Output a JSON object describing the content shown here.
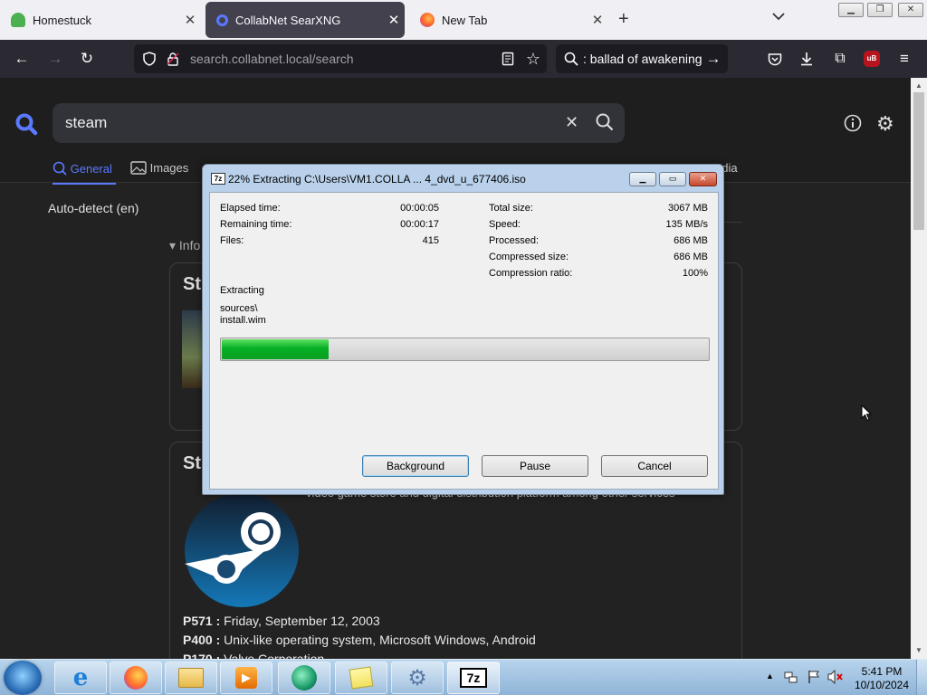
{
  "browser": {
    "tabs": [
      {
        "title": "Homestuck"
      },
      {
        "title": "CollabNet SearXNG"
      },
      {
        "title": "New Tab"
      }
    ],
    "url_domain": "search.collabnet.local",
    "url_path": "/search",
    "search_bar_text": ": ballad of awakening",
    "ublock_badge": "uB"
  },
  "searx": {
    "query": "steam",
    "tabs": {
      "general": "General",
      "images": "Images",
      "media": "edia"
    },
    "language": "Auto-detect (en)",
    "info_label": "▾ Info",
    "infobox_title": "St",
    "infobox2_title": "St",
    "description_fragment": "video game store and digital distribution platform among other services",
    "properties": [
      {
        "key": "P571 :",
        "value": " Friday, September 12, 2003"
      },
      {
        "key": "P400 :",
        "value": " Unix-like operating system, Microsoft Windows, Android"
      },
      {
        "key": "P170 :",
        "value": " Valve Corporation"
      }
    ]
  },
  "dialog": {
    "title": "22% Extracting C:\\Users\\VM1.COLLA ... 4_dvd_u_677406.iso",
    "icon_text": "7z",
    "progress_fraction": 0.22,
    "stats_left": [
      {
        "label": "Elapsed time:",
        "value": "00:00:05"
      },
      {
        "label": "Remaining time:",
        "value": "00:00:17"
      },
      {
        "label": "Files:",
        "value": "415"
      }
    ],
    "stats_right": [
      {
        "label": "Total size:",
        "value": "3067 MB"
      },
      {
        "label": "Speed:",
        "value": "135 MB/s"
      },
      {
        "label": "Processed:",
        "value": "686 MB"
      },
      {
        "label": "Compressed size:",
        "value": "686 MB"
      },
      {
        "label": "Compression ratio:",
        "value": "100%"
      }
    ],
    "operation": "Extracting",
    "path_line1": "sources\\",
    "path_line2": "install.wim",
    "buttons": {
      "background": "Background",
      "pause": "Pause",
      "cancel": "Cancel"
    }
  },
  "taskbar": {
    "time": "5:41 PM",
    "date": "10/10/2024",
    "sevenzip_label": "7z"
  },
  "colors": {
    "accent": "#5b79ff",
    "progress_green": "#06b025",
    "page_bg": "#222222"
  }
}
